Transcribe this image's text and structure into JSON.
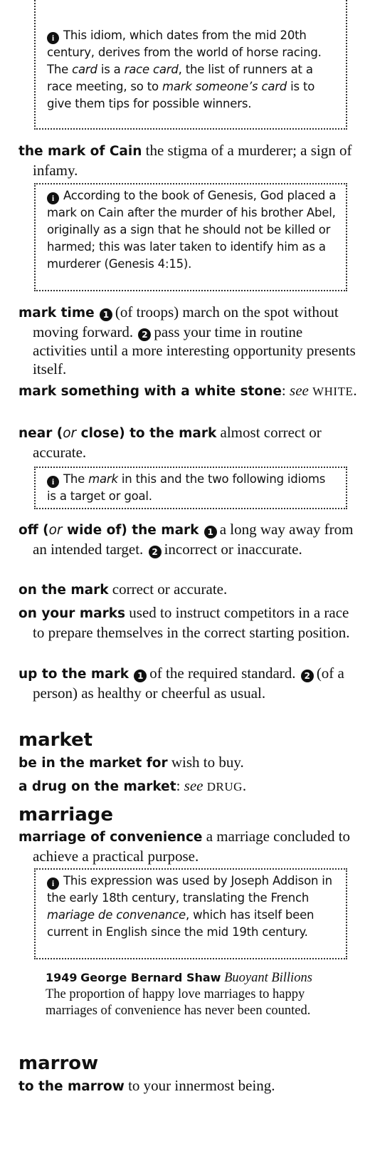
{
  "notes": {
    "card": {
      "before": "This idiom, which dates from the mid 20th century, derives from the world of horse racing. The ",
      "em1": "card",
      "mid1": " is a ",
      "em2": "race card",
      "mid2": ", the list of runners at a race meeting, so to ",
      "em3": "mark someone’s card",
      "after": " is to give them tips for possible winners."
    },
    "cain": "According to the book of Genesis, God placed a mark on Cain after the murder of his brother Abel, originally as a sign that he should not be killed or harmed; this was later taken to identify him as a murderer (Genesis 4:15).",
    "target": {
      "before": "The ",
      "em": "mark",
      "after": " in this and the two following idioms is a target or goal."
    },
    "convenance": {
      "before": "This expression was used by Joseph Addison in the early 18th century, translating the French ",
      "em": "mariage de convenance",
      "after": ", which has itself been current in English since the mid 19th century."
    }
  },
  "entries": {
    "mark_of_cain": {
      "phrase": "the mark of Cain",
      "definition": " the stigma of a murderer; a sign of infamy."
    },
    "mark_time": {
      "phrase": "mark time",
      "sense1_num": "1",
      "sense1": "(of troops) march on the spot without moving forward.",
      "sense2_num": "2",
      "sense2": "pass your time in routine activities until a more interesting opportunity presents itself."
    },
    "white_stone": {
      "phrase": "mark something with a white stone",
      "sep": ": ",
      "see": "see",
      "ref": "WHITE",
      "end": "."
    },
    "near_mark": {
      "phrase1": "near (",
      "or": "or",
      "phrase2": " close) to the mark",
      "definition": " almost correct or accurate."
    },
    "off_mark": {
      "phrase1": "off (",
      "or": "or",
      "phrase2": " wide of) the mark",
      "sense1_num": "1",
      "sense1": "a long way away from an intended target.",
      "sense2_num": "2",
      "sense2": "incorrect or inaccurate."
    },
    "on_the_mark": {
      "phrase": "on the mark",
      "definition": " correct or accurate."
    },
    "on_your_marks": {
      "phrase": "on your marks",
      "definition": " used to instruct competitors in a race to prepare themselves in the correct starting position."
    },
    "up_to_mark": {
      "phrase": "up to the mark",
      "sense1_num": "1",
      "sense1": "of the required standard.",
      "sense2_num": "2",
      "sense2": "(of a person) as healthy or cheerful as usual."
    },
    "in_the_market": {
      "phrase": "be in the market for",
      "definition": " wish to buy."
    },
    "drug_market": {
      "phrase": "a drug on the market",
      "sep": ": ",
      "see": "see",
      "ref": "DRUG",
      "end": "."
    },
    "convenience": {
      "phrase": "marriage of convenience",
      "definition": " a marriage concluded to achieve a practical purpose."
    },
    "to_the_marrow": {
      "phrase": "to the marrow",
      "definition": " to your innermost being."
    }
  },
  "headwords": {
    "market": "market",
    "marriage": "marriage",
    "marrow": "marrow"
  },
  "quote": {
    "year": "1949",
    "author": "George Bernard Shaw",
    "title": "Buoyant Billions",
    "text": "The proportion of happy love marriages to happy marriages of convenience has never been counted."
  },
  "info_icon": "i"
}
